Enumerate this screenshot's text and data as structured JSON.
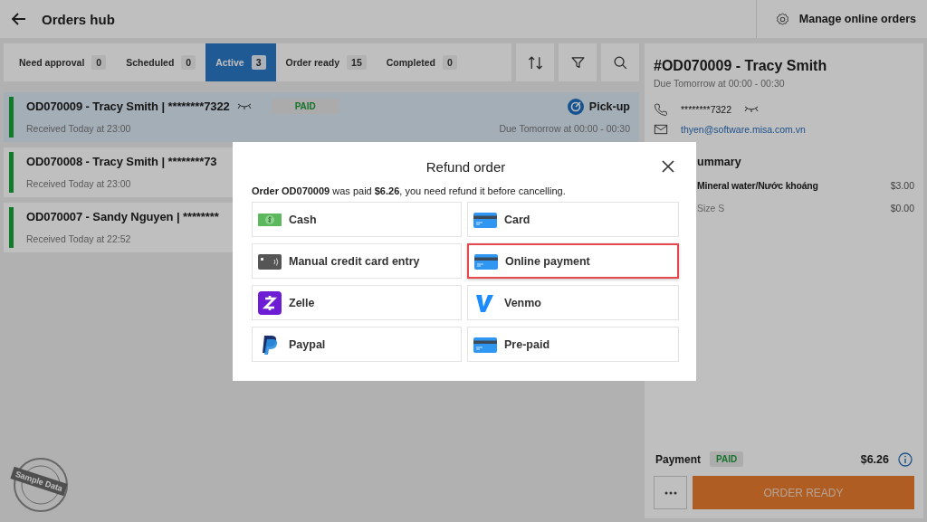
{
  "header": {
    "title": "Orders hub",
    "manage_label": "Manage online orders"
  },
  "tabs": [
    {
      "label": "Need approval",
      "count": "0",
      "selected": false
    },
    {
      "label": "Scheduled",
      "count": "0",
      "selected": false
    },
    {
      "label": "Active",
      "count": "3",
      "selected": true
    },
    {
      "label": "Order ready",
      "count": "15",
      "selected": false
    },
    {
      "label": "Completed",
      "count": "0",
      "selected": false
    }
  ],
  "orders": [
    {
      "title": "OD070009 - Tracy Smith | ********7322",
      "received": "Received Today at 23:00",
      "payment_status": "PAID",
      "delivery": "Pick-up",
      "due": "Due Tomorrow at 00:00 - 00:30",
      "selected": true
    },
    {
      "title": "OD070008 - Tracy Smith | ********73",
      "received": "Received Today at 23:00",
      "selected": false
    },
    {
      "title": "OD070007 - Sandy Nguyen | ********",
      "received": "Received Today at 22:52",
      "selected": false
    }
  ],
  "detail": {
    "title": "#OD070009 - Tracy Smith",
    "due": "Due Tomorrow at 00:00 - 00:30",
    "phone": "********7322",
    "email": "thyen@software.misa.com.vn",
    "summary_heading": "ummary",
    "items": [
      {
        "name": "Mineral water/Nước khoáng",
        "price": "$3.00",
        "kind": "item"
      },
      {
        "name": "Size S",
        "price": "$0.00",
        "kind": "option"
      }
    ],
    "payment_label": "Payment",
    "payment_status": "PAID",
    "total": "$6.26",
    "order_ready": "ORDER READY"
  },
  "modal": {
    "title": "Refund order",
    "message": "**Order OD070009** was paid **$6.26**, you need refund it before cancelling.",
    "options": [
      {
        "label": "Cash",
        "kind": "cash",
        "selected": false
      },
      {
        "label": "Card",
        "kind": "card",
        "selected": false
      },
      {
        "label": "Manual credit card entry",
        "kind": "manual",
        "selected": false
      },
      {
        "label": "Online payment",
        "kind": "card",
        "selected": true
      },
      {
        "label": "Zelle",
        "kind": "zelle",
        "selected": false
      },
      {
        "label": "Venmo",
        "kind": "venmo",
        "selected": false
      },
      {
        "label": "Paypal",
        "kind": "paypal",
        "selected": false
      },
      {
        "label": "Pre-paid",
        "kind": "card",
        "selected": false
      }
    ]
  },
  "stamp": "Sample Data"
}
